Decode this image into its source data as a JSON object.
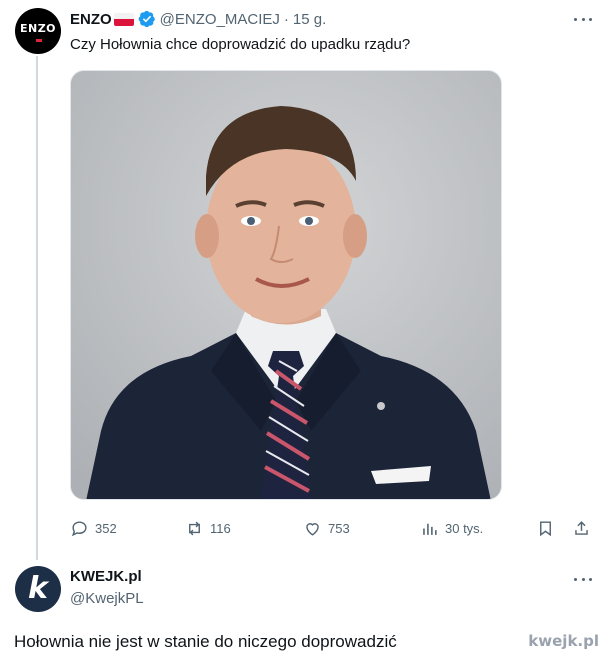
{
  "tweet": {
    "author": {
      "display_name": "ENZO",
      "flag": "poland-flag",
      "verified": true,
      "handle": "@ENZO_MACIEJ",
      "avatar_text": "ENZO"
    },
    "separator": "·",
    "time": "15 g.",
    "text": "Czy Hołownia chce doprowadzić do upadku rządu?",
    "image": "portrait-photo",
    "actions": {
      "replies": "352",
      "retweets": "116",
      "likes": "753",
      "views": "30 tys."
    }
  },
  "reply": {
    "display_name": "KWEJK.pl",
    "handle": "@KwejkPL",
    "avatar_letter": "k",
    "text": "Hołownia nie jest w stanie do niczego doprowadzić"
  },
  "watermark": "kwejk.pl",
  "colors": {
    "text": "#0f1419",
    "secondary": "#536471",
    "verified": "#1d9bf0",
    "thread_line": "#cfd9de"
  }
}
